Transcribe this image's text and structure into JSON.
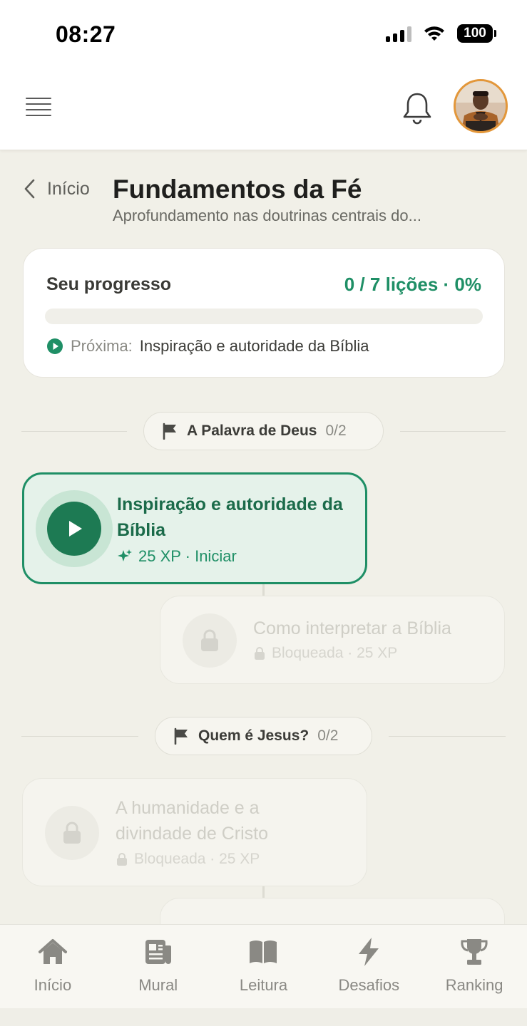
{
  "status_bar": {
    "time": "08:27",
    "battery": "100"
  },
  "header": {
    "menu_icon": "hamburger-menu-icon",
    "notification_icon": "bell-icon",
    "avatar_icon": "user-avatar",
    "colors": {
      "avatar_ring": "#e3973a"
    }
  },
  "page": {
    "back_label": "Início",
    "title": "Fundamentos da Fé",
    "subtitle": "Aprofundamento nas doutrinas centrais do..."
  },
  "progress": {
    "label": "Seu progresso",
    "stats": "0 / 7 lições · 0%",
    "completed": 0,
    "total": 7,
    "percent": 0,
    "next_prefix": "Próxima:",
    "next_title": "Inspiração e autoridade da Bíblia"
  },
  "sections": [
    {
      "name": "A Palavra de Deus",
      "count": "0/2",
      "lessons": [
        {
          "title": "Inspiração e autoridade da Bíblia",
          "meta": "25 XP · Iniciar",
          "status": "available"
        },
        {
          "title": "Como interpretar a Bíblia",
          "meta": "Bloqueada · 25 XP",
          "status": "locked"
        }
      ]
    },
    {
      "name": "Quem é Jesus?",
      "count": "0/2",
      "lessons": [
        {
          "title": "A humanidade e a divindade de Cristo",
          "meta": "Bloqueada · 25 XP",
          "status": "locked"
        }
      ]
    }
  ],
  "bottom_nav": [
    {
      "label": "Início",
      "icon": "home-icon"
    },
    {
      "label": "Mural",
      "icon": "newspaper-icon"
    },
    {
      "label": "Leitura",
      "icon": "book-icon"
    },
    {
      "label": "Desafios",
      "icon": "lightning-icon"
    },
    {
      "label": "Ranking",
      "icon": "trophy-icon"
    }
  ],
  "colors": {
    "accent": "#1f8f66",
    "accent_dark": "#1d7a53",
    "background": "#f1f0e8"
  }
}
